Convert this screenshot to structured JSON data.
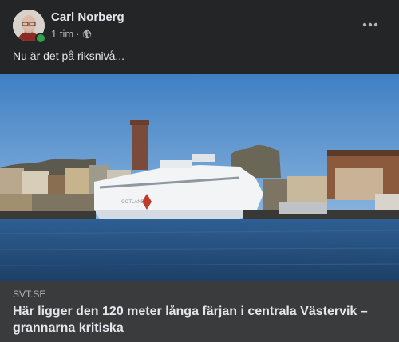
{
  "post": {
    "author": "Carl Norberg",
    "time": "1 tim",
    "separator": "·",
    "audience_icon": "globe-icon",
    "more_icon": "more-horizontal-icon",
    "text": "Nu är det på riksnivå..."
  },
  "link": {
    "domain": "SVT.SE",
    "headline": "Här ligger den 120 meter långa färjan i centrala Västervik – grannarna kritiska",
    "image_subject": "white ferry in harbor",
    "ferry_hull_text": "GOTLAND"
  },
  "colors": {
    "background": "#242526",
    "preview_bg": "#3a3b3c",
    "text_primary": "#e4e6eb",
    "text_secondary": "#b0b3b8",
    "online": "#31a24c"
  }
}
